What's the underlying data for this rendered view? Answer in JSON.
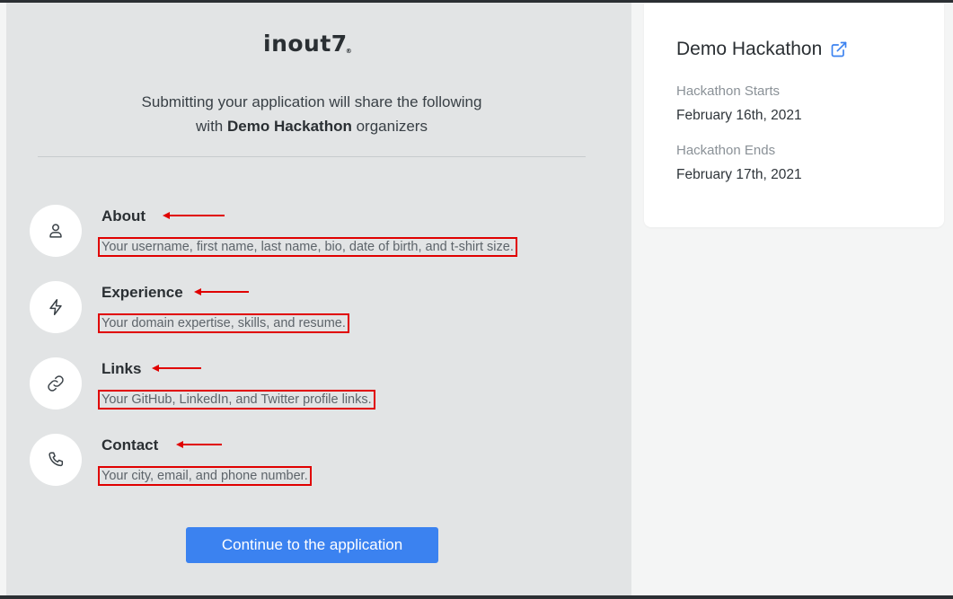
{
  "brand": {
    "logo_text": "inout7",
    "logo_reg": "®"
  },
  "intro": {
    "line1": "Submitting your application will share the following",
    "line2_prefix": "with",
    "line2_org": "Demo Hackathon",
    "line2_suffix": "organizers"
  },
  "sections": [
    {
      "icon": "user-icon",
      "title": "About",
      "description": "Your username, first name, last name, bio, date of birth, and t-shirt size."
    },
    {
      "icon": "lightning-icon",
      "title": "Experience",
      "description": "Your domain expertise, skills, and resume."
    },
    {
      "icon": "link-icon",
      "title": "Links",
      "description": "Your GitHub, LinkedIn, and Twitter profile links."
    },
    {
      "icon": "phone-icon",
      "title": "Contact",
      "description": "Your city, email, and phone number."
    }
  ],
  "cta": {
    "label": "Continue to the application"
  },
  "sidebar": {
    "title": "Demo Hackathon",
    "title_icon": "external-link-icon",
    "starts_label": "Hackathon Starts",
    "starts_value": "February 16th, 2021",
    "ends_label": "Hackathon Ends",
    "ends_value": "February 17th, 2021"
  },
  "colors": {
    "accent": "#3b82f0",
    "highlight_box": "#e00000",
    "panel_bg": "#e2e4e5"
  }
}
